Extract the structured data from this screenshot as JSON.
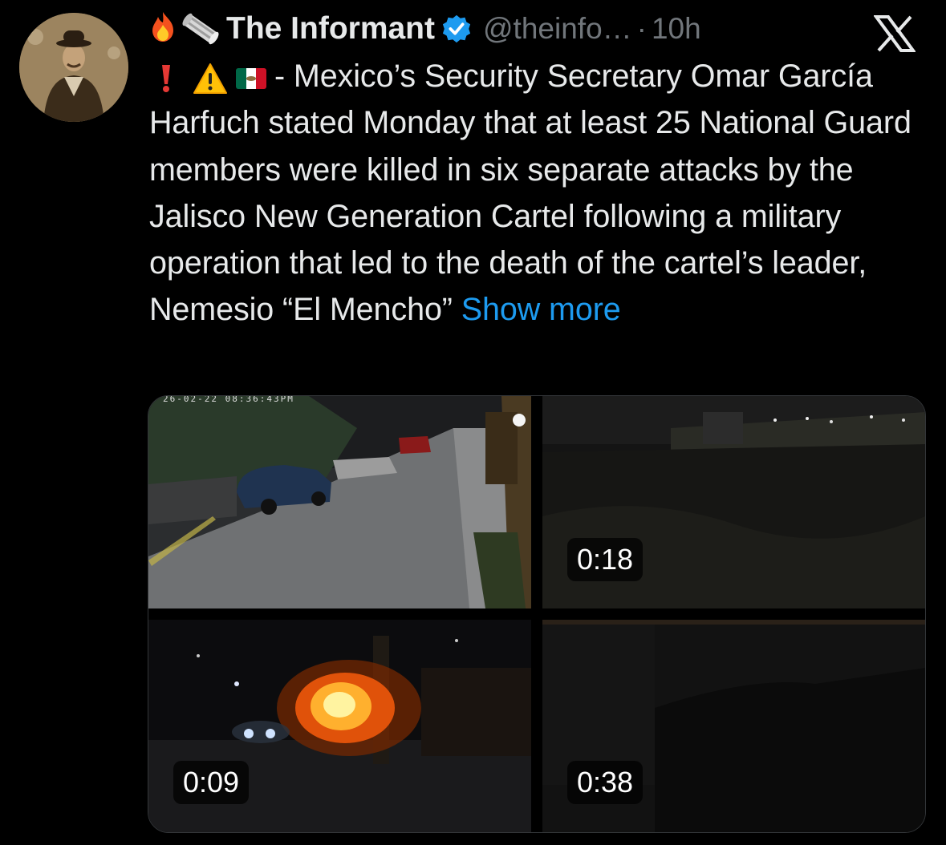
{
  "tweet": {
    "author_name": "The Informant",
    "handle": "@theinfo…",
    "separator": "·",
    "time": "10h",
    "body_text": "- Mexico’s Security Secretary Omar García Harfuch stated Monday that at least 25 National Guard members were killed in six separate attacks by the Jalisco New Generation Cartel following a military operation that led to the death of the cartel’s leader, Nemesio “El Mencho”",
    "show_more": "Show more",
    "name_emojis": [
      "fire-emoji",
      "scroll-emoji"
    ],
    "lead_emojis": [
      "red-exclamation-emoji",
      "warning-emoji",
      "mexico-flag-emoji"
    ],
    "link_color": "#1d9bf0",
    "verified_color": "#1d9bf0"
  },
  "media": {
    "tiles": [
      {
        "name": "cctv-street-video",
        "timestamp": "26-02-22 08:36:43PM",
        "duration": ""
      },
      {
        "name": "night-field-video",
        "duration": "0:18"
      },
      {
        "name": "burning-vehicle-video",
        "duration": "0:09"
      },
      {
        "name": "dark-night-video",
        "duration": "0:38"
      }
    ]
  }
}
